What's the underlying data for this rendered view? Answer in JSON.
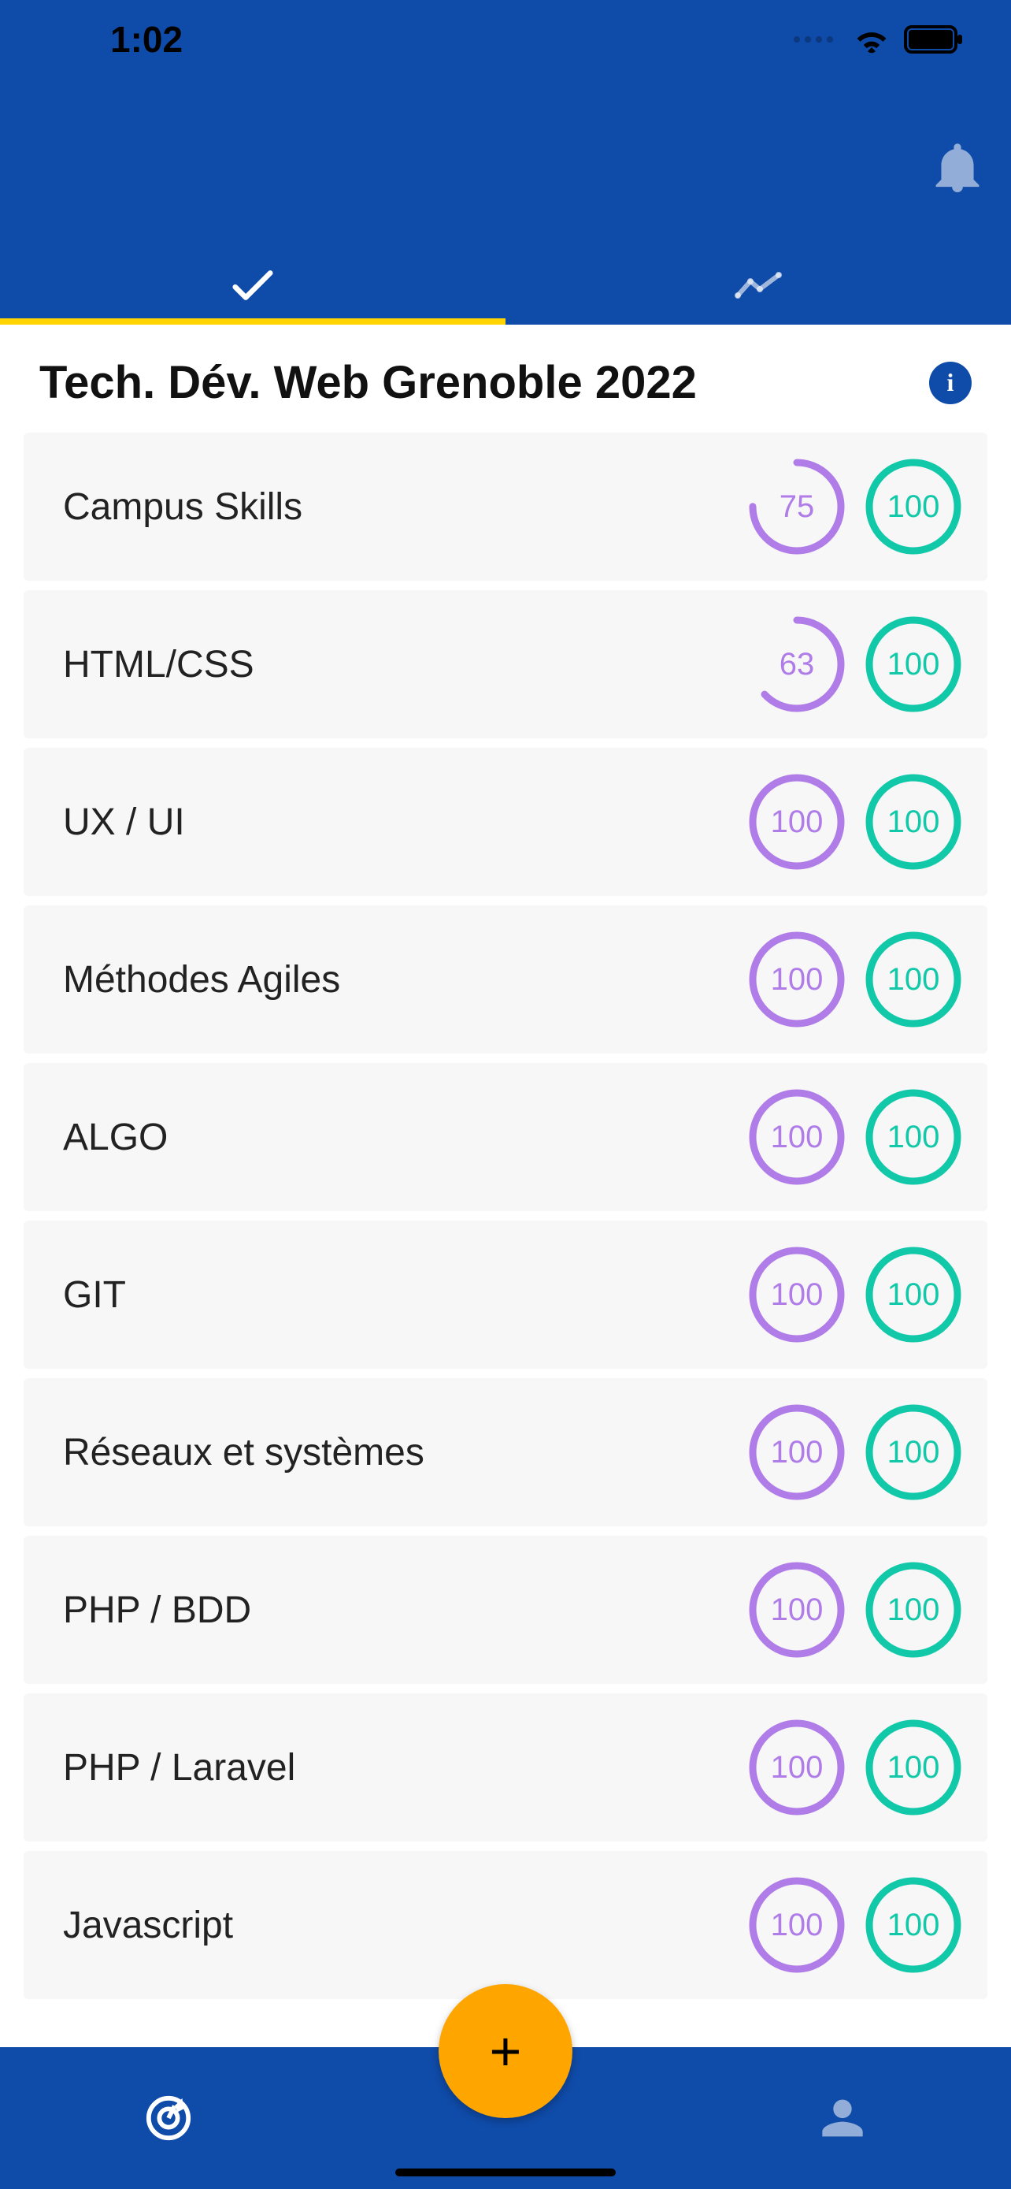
{
  "status": {
    "time": "1:02"
  },
  "header": {
    "tabs": {
      "active": 0
    }
  },
  "page": {
    "title": "Tech. Dév. Web Grenoble 2022",
    "info_label": "i"
  },
  "colors": {
    "purple": "#B07CE8",
    "teal": "#11C8A8"
  },
  "skills": [
    {
      "label": "Campus Skills",
      "score1": 75,
      "score2": 100
    },
    {
      "label": "HTML/CSS",
      "score1": 63,
      "score2": 100
    },
    {
      "label": "UX / UI",
      "score1": 100,
      "score2": 100
    },
    {
      "label": "Méthodes Agiles",
      "score1": 100,
      "score2": 100
    },
    {
      "label": "ALGO",
      "score1": 100,
      "score2": 100
    },
    {
      "label": "GIT",
      "score1": 100,
      "score2": 100
    },
    {
      "label": "Réseaux et systèmes",
      "score1": 100,
      "score2": 100
    },
    {
      "label": "PHP / BDD",
      "score1": 100,
      "score2": 100
    },
    {
      "label": "PHP / Laravel",
      "score1": 100,
      "score2": 100
    },
    {
      "label": "Javascript",
      "score1": 100,
      "score2": 100
    }
  ],
  "fab": {
    "label": "+"
  }
}
